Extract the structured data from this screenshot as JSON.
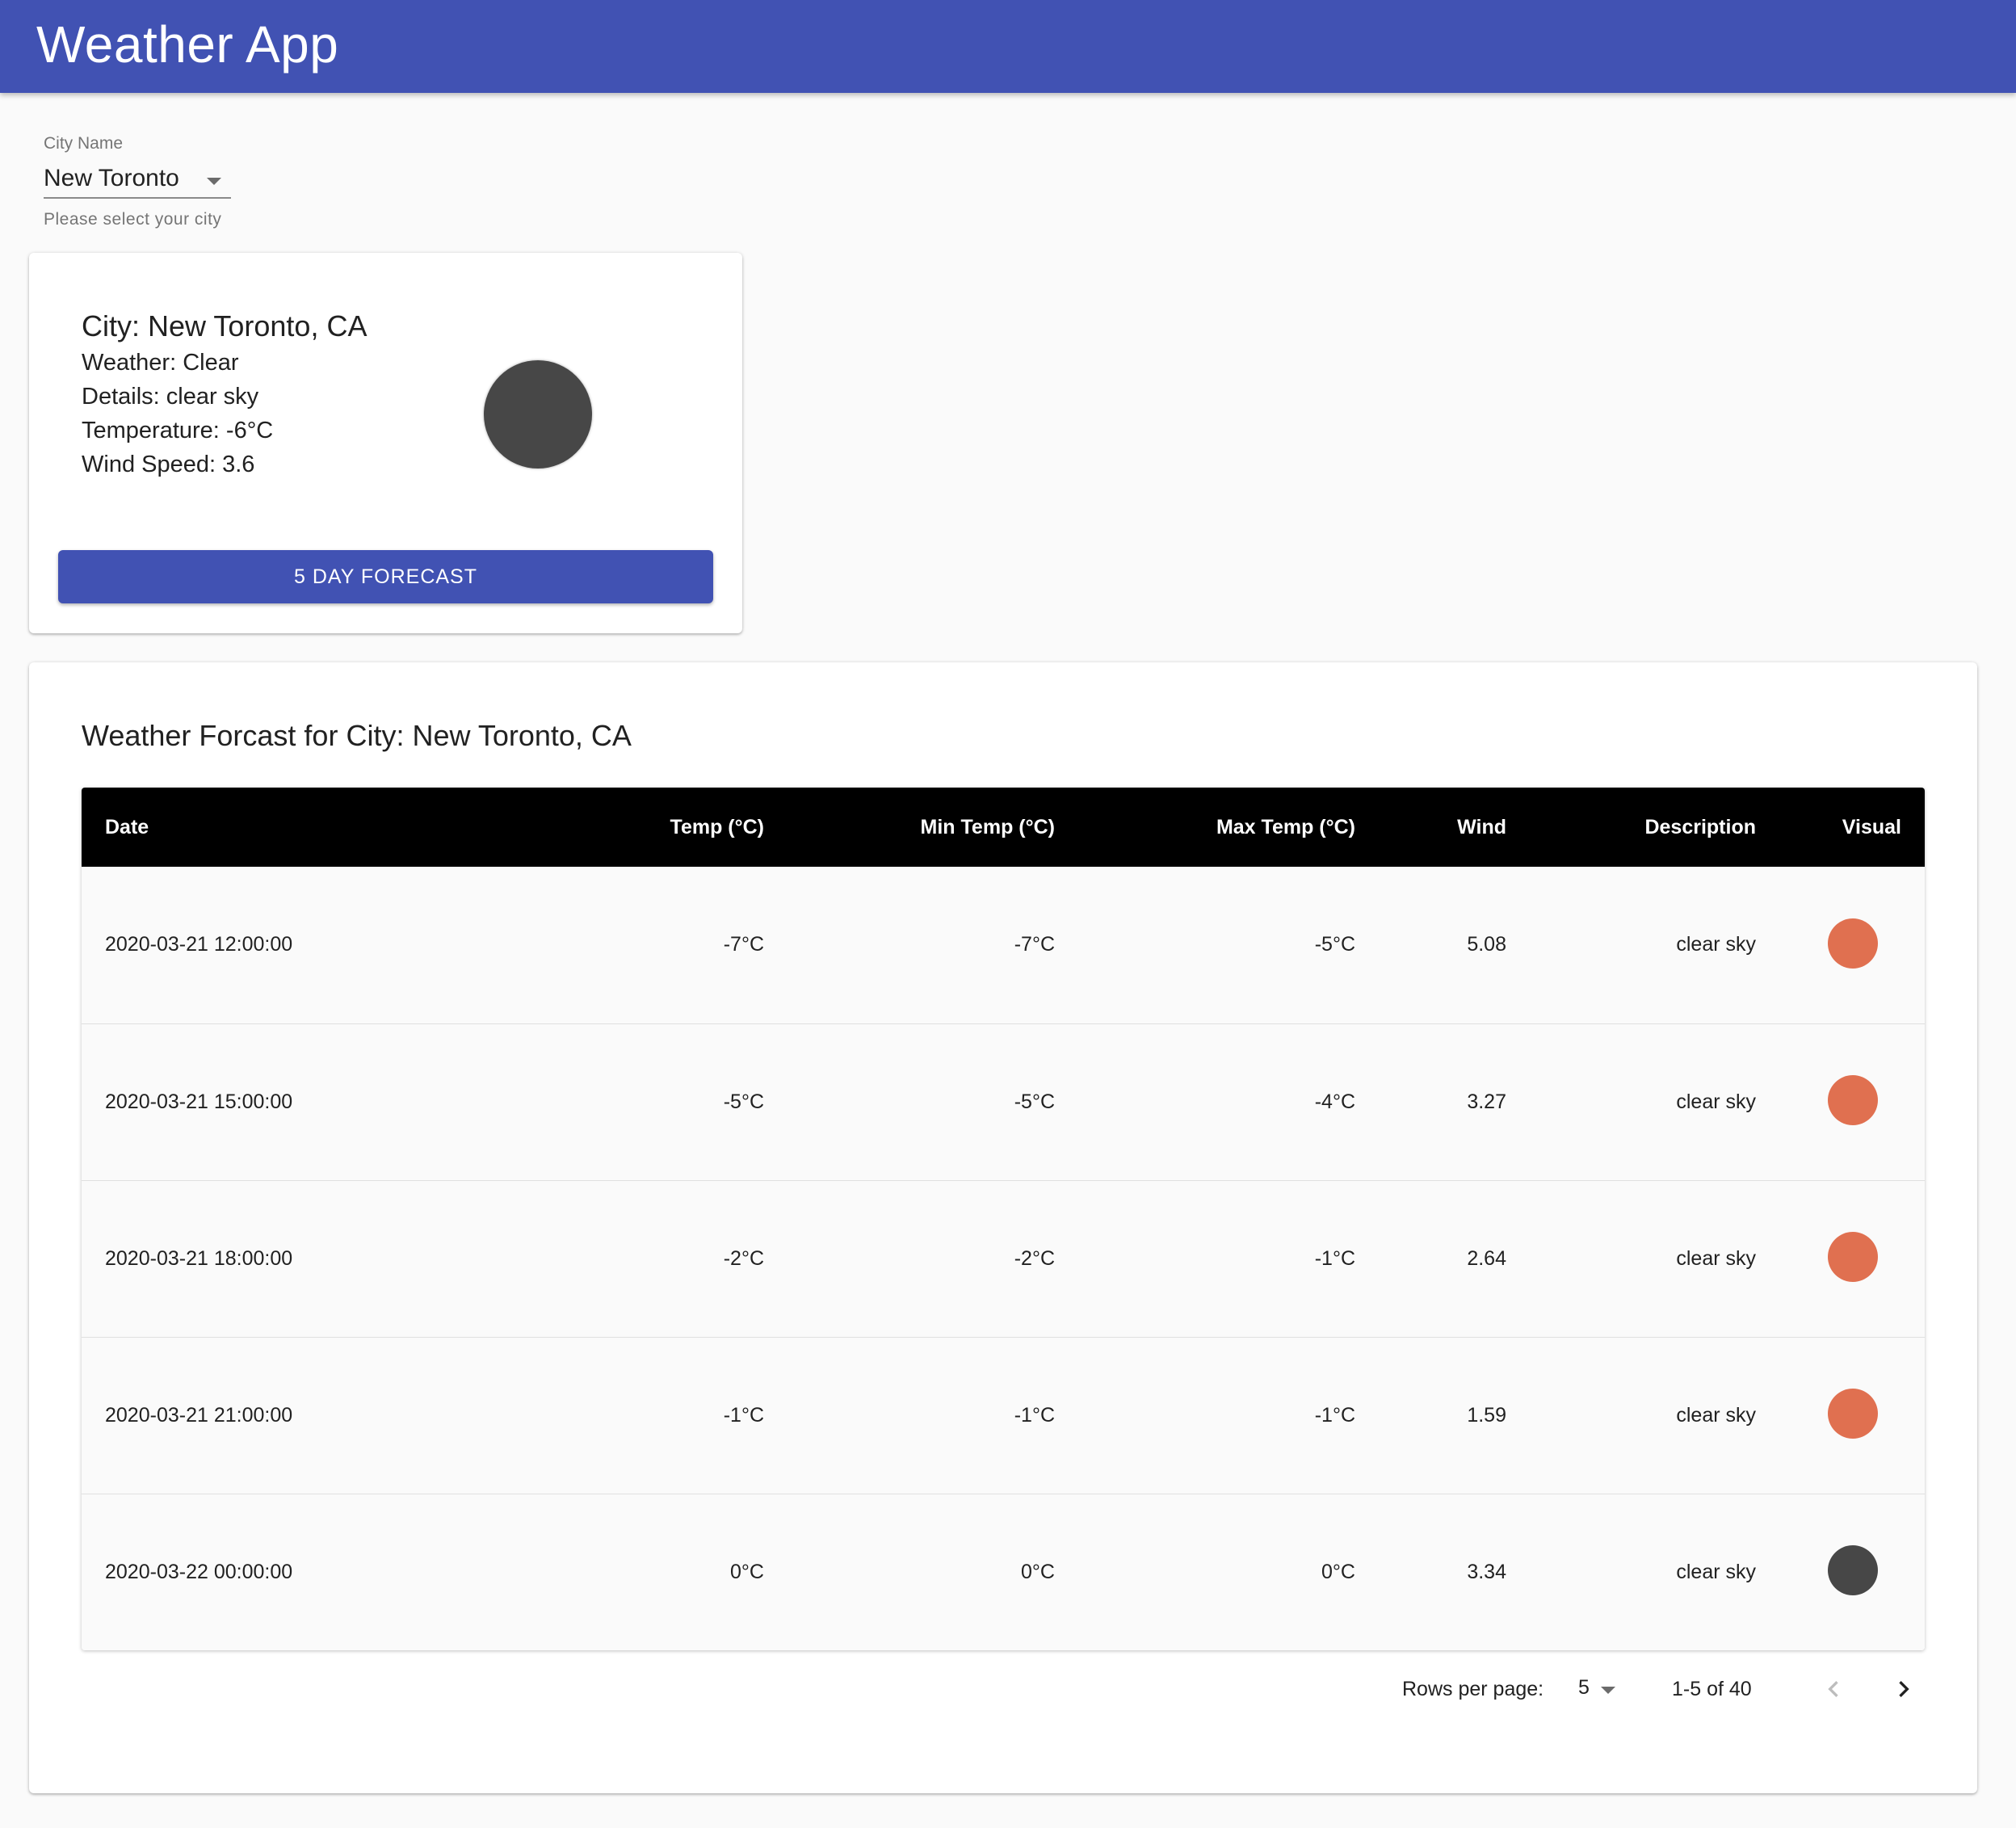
{
  "app": {
    "title": "Weather App"
  },
  "city_select": {
    "label": "City Name",
    "value": "New Toronto",
    "helper": "Please select your city"
  },
  "current": {
    "title": "City: New Toronto, CA",
    "weather": "Weather: Clear",
    "details": "Details: clear sky",
    "temperature": "Temperature: -6°C",
    "wind": "Wind Speed: 3.6",
    "visual_color": "#474747",
    "button_label": "5 DAY FORECAST"
  },
  "forecast": {
    "title": "Weather Forcast for City: New Toronto, CA",
    "columns": [
      "Date",
      "Temp (°C)",
      "Min Temp (°C)",
      "Max Temp (°C)",
      "Wind",
      "Description",
      "Visual"
    ],
    "rows": [
      {
        "date": "2020-03-21 12:00:00",
        "temp": "-7°C",
        "min": "-7°C",
        "max": "-5°C",
        "wind": "5.08",
        "desc": "clear sky",
        "visual_color": "#e07050"
      },
      {
        "date": "2020-03-21 15:00:00",
        "temp": "-5°C",
        "min": "-5°C",
        "max": "-4°C",
        "wind": "3.27",
        "desc": "clear sky",
        "visual_color": "#e07050"
      },
      {
        "date": "2020-03-21 18:00:00",
        "temp": "-2°C",
        "min": "-2°C",
        "max": "-1°C",
        "wind": "2.64",
        "desc": "clear sky",
        "visual_color": "#e07050"
      },
      {
        "date": "2020-03-21 21:00:00",
        "temp": "-1°C",
        "min": "-1°C",
        "max": "-1°C",
        "wind": "1.59",
        "desc": "clear sky",
        "visual_color": "#e07050"
      },
      {
        "date": "2020-03-22 00:00:00",
        "temp": "0°C",
        "min": "0°C",
        "max": "0°C",
        "wind": "3.34",
        "desc": "clear sky",
        "visual_color": "#474747"
      }
    ]
  },
  "pagination": {
    "rows_per_page_label": "Rows per page:",
    "rows_per_page": "5",
    "range": "1-5 of 40",
    "prev_icon": "chevron-left-icon",
    "next_icon": "chevron-right-icon"
  },
  "colors": {
    "primary": "#4152b3",
    "header_bg": "#000000",
    "warm_dot": "#e07050",
    "dark_dot": "#474747"
  }
}
